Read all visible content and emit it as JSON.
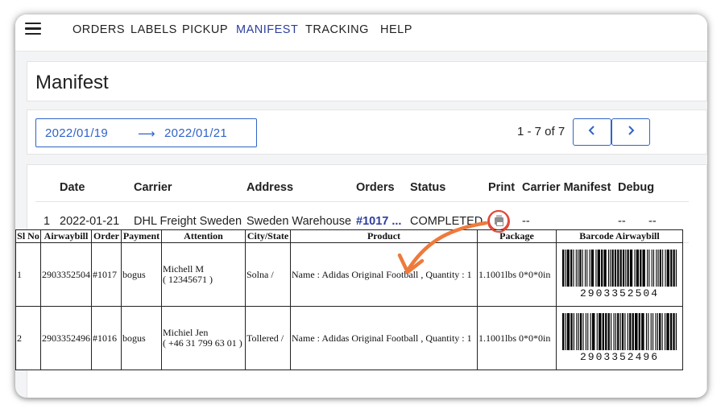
{
  "nav": {
    "items": [
      {
        "label": "ORDERS",
        "active": false
      },
      {
        "label": "LABELS",
        "active": false
      },
      {
        "label": "PICKUP",
        "active": false
      },
      {
        "label": "MANIFEST",
        "active": true
      },
      {
        "label": "TRACKING",
        "active": false
      },
      {
        "label": "HELP",
        "active": false
      }
    ]
  },
  "page": {
    "title": "Manifest"
  },
  "filter": {
    "date_from": "2022/01/19",
    "date_to": "2022/01/21",
    "pager_label": "1 - 7 of 7",
    "prev_icon": "chevron-left-icon",
    "next_icon": "chevron-right-icon"
  },
  "list": {
    "headers": [
      "Date",
      "Carrier",
      "Address",
      "Orders",
      "Status",
      "Print",
      "Carrier Manifest",
      "Debug"
    ],
    "rows": [
      {
        "index": "1",
        "date": "2022-01-21",
        "carrier": "DHL Freight Sweden",
        "address": "Sweden Warehouse",
        "orders": "#1017 ...",
        "status": "COMPLETED",
        "print_icon": "printer-icon",
        "carrier_manifest": "--",
        "debug_1": "--",
        "debug_2": "--"
      }
    ]
  },
  "manifest": {
    "headers": [
      "Sl No",
      "Airwaybill",
      "Order",
      "Payment",
      "Attention",
      "City/State",
      "Product",
      "Package",
      "Barcode Airwaybill"
    ],
    "rows": [
      {
        "sl": "1",
        "awb": "2903352504",
        "order": "#1017",
        "payment": "bogus",
        "attention_name": "Michell M",
        "attention_phone": "( 12345671 )",
        "city": "Solna /",
        "product": "Name : Adidas Original Football , Quantity : 1",
        "package": "1.1001lbs 0*0*0in",
        "barcode": "2903352504"
      },
      {
        "sl": "2",
        "awb": "2903352496",
        "order": "#1016",
        "payment": "bogus",
        "attention_name": "Michiel Jen",
        "attention_phone": "( +46 31 799 63 01 )",
        "city": "Tollered /",
        "product": "Name : Adidas Original Football , Quantity : 1",
        "package": "1.1001lbs 0*0*0in",
        "barcode": "2903352496"
      }
    ]
  },
  "colors": {
    "accent": "#2f64c8",
    "nav_active": "#2d3e9c",
    "annotation": "#ee7a3b",
    "highlight": "#e04a3a"
  }
}
